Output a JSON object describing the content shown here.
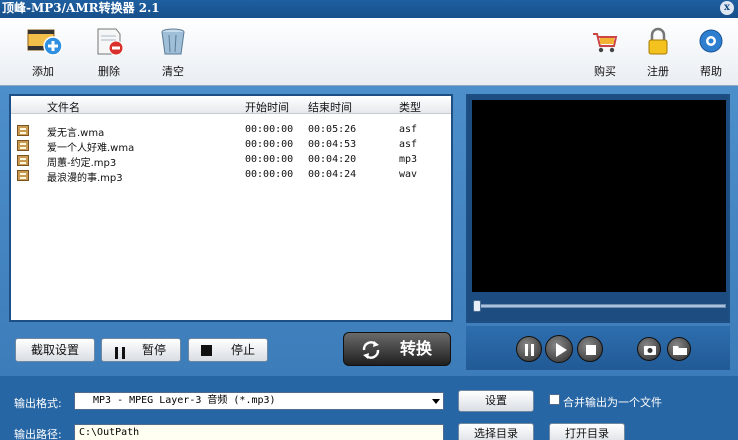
{
  "window": {
    "title": "顶峰-MP3/AMR转换器 2.1",
    "close": "x"
  },
  "toolbar": {
    "add": "添加",
    "delete": "删除",
    "clear": "清空",
    "buy": "购买",
    "register": "注册",
    "help": "帮助"
  },
  "file_list": {
    "columns": [
      "文件名",
      "开始时间",
      "结束时间",
      "类型"
    ],
    "rows": [
      {
        "name": "爱无言.wma",
        "start": "00:00:00",
        "end": "00:05:26",
        "type": "asf"
      },
      {
        "name": "爱一个人好难.wma",
        "start": "00:00:00",
        "end": "00:04:53",
        "type": "asf"
      },
      {
        "name": "周蕙-约定.mp3",
        "start": "00:00:00",
        "end": "00:04:20",
        "type": "mp3"
      },
      {
        "name": "最浪漫的事.mp3",
        "start": "00:00:00",
        "end": "00:04:24",
        "type": "wav"
      }
    ]
  },
  "buttons": {
    "clip_settings": "截取设置",
    "pause": "暂停",
    "stop": "停止",
    "convert": "转换"
  },
  "output": {
    "format_label": "输出格式:",
    "format_value": "MP3 - MPEG Layer-3 音频 (*.mp3)",
    "settings": "设置",
    "merge_label": "合并输出为一个文件",
    "path_label": "输出路径:",
    "path_value": "C:\\OutPath",
    "choose_dir": "选择目录",
    "open_dir": "打开目录"
  },
  "player": {
    "seek_position": 0
  },
  "colors": {
    "accent": "#2766a4",
    "screen": "#000000"
  }
}
